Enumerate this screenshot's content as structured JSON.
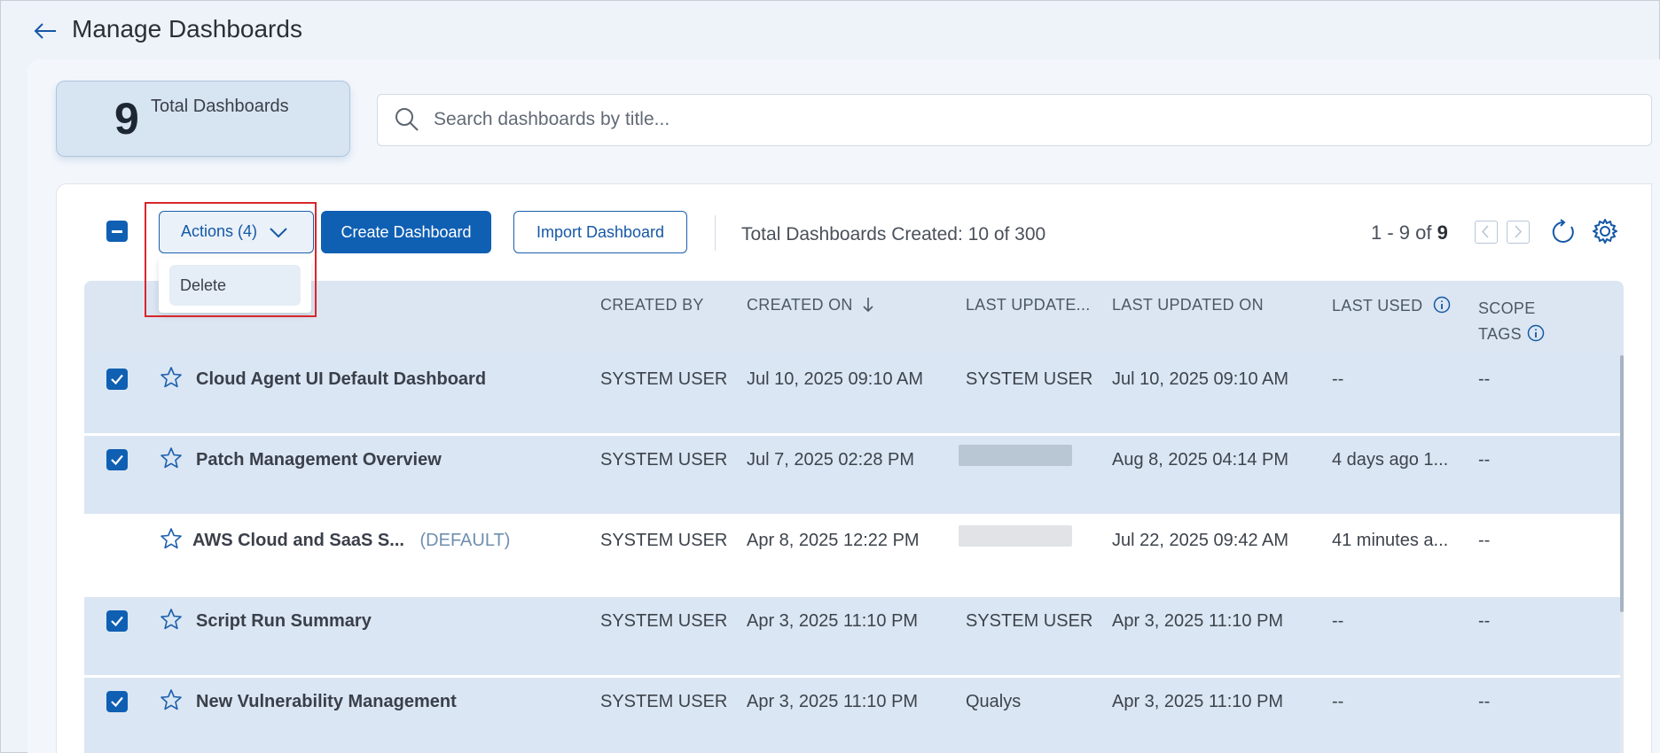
{
  "page": {
    "title": "Manage Dashboards"
  },
  "summary": {
    "count": "9",
    "label": "Total Dashboards"
  },
  "search": {
    "placeholder": "Search dashboards by title..."
  },
  "toolbar": {
    "actions_label": "Actions (4)",
    "create_label": "Create Dashboard",
    "import_label": "Import Dashboard",
    "total_created": "Total Dashboards Created: 10 of 300",
    "pager_range": "1 - 9 of",
    "pager_total": "9"
  },
  "actions_menu": {
    "items": [
      "Delete"
    ]
  },
  "table": {
    "columns": {
      "created_by": "CREATED BY",
      "created_on": "CREATED ON",
      "last_updated_by": "LAST UPDATE...",
      "last_updated_on": "LAST UPDATED ON",
      "last_used": "LAST USED",
      "scope_tags_1": "SCOPE",
      "scope_tags_2": "TAGS"
    },
    "rows": [
      {
        "name": "Cloud Agent UI Default Dashboard",
        "tag": "",
        "created_by": "SYSTEM USER",
        "created_on": "Jul 10, 2025 09:10 AM",
        "last_updated_by": "SYSTEM USER",
        "last_updated_on": "Jul 10, 2025 09:10 AM",
        "last_used": "--",
        "scope_tags": "--",
        "selected": true
      },
      {
        "name": "Patch Management Overview",
        "tag": "",
        "created_by": "SYSTEM USER",
        "created_on": "Jul 7, 2025 02:28 PM",
        "last_updated_by": "",
        "last_updated_on": "Aug 8, 2025 04:14 PM",
        "last_used": "4 days ago 1...",
        "scope_tags": "--",
        "selected": true
      },
      {
        "name": "AWS Cloud and SaaS S...",
        "tag": "(DEFAULT)",
        "created_by": "SYSTEM USER",
        "created_on": "Apr 8, 2025 12:22 PM",
        "last_updated_by": "",
        "last_updated_on": "Jul 22, 2025 09:42 AM",
        "last_used": "41 minutes a...",
        "scope_tags": "--",
        "selected": false
      },
      {
        "name": "Script Run Summary",
        "tag": "",
        "created_by": "SYSTEM USER",
        "created_on": "Apr 3, 2025 11:10 PM",
        "last_updated_by": "SYSTEM USER",
        "last_updated_on": "Apr 3, 2025 11:10 PM",
        "last_used": "--",
        "scope_tags": "--",
        "selected": true
      },
      {
        "name": "New Vulnerability Management",
        "tag": "",
        "created_by": "SYSTEM USER",
        "created_on": "Apr 3, 2025 11:10 PM",
        "last_updated_by": "Qualys",
        "last_updated_on": "Apr 3, 2025 11:10 PM",
        "last_used": "--",
        "scope_tags": "--",
        "selected": true
      }
    ]
  },
  "colors": {
    "primary": "#0f5fb3",
    "selected_row": "#dae6f3",
    "header_bg": "#dbe6f2",
    "highlight": "#d8262b"
  }
}
